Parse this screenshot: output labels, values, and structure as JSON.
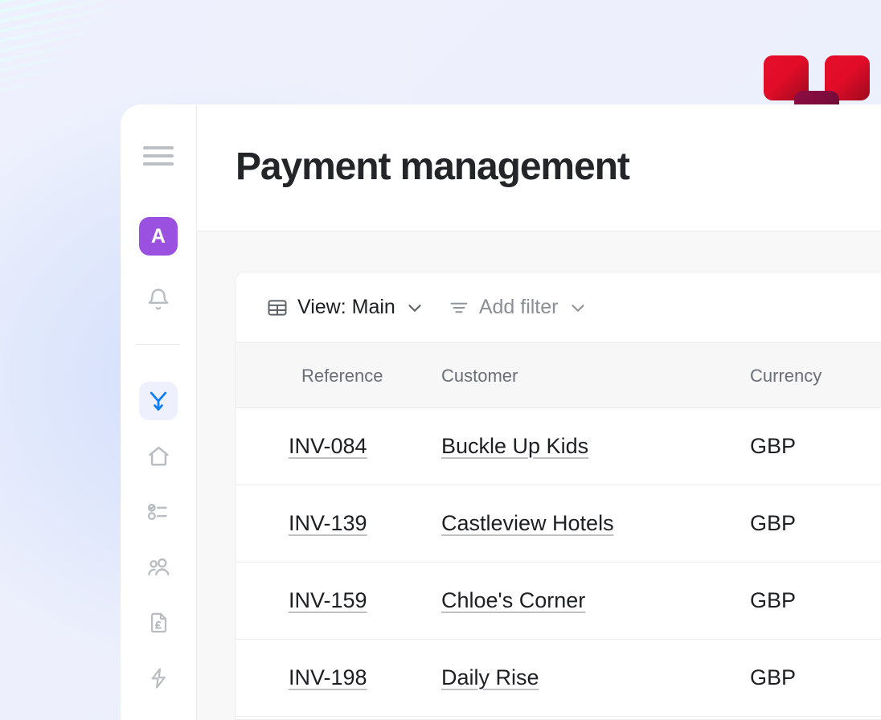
{
  "window": {
    "title": "Payment management"
  },
  "logo": {
    "name": "brand-logo-mark",
    "colors": {
      "red": "#e20c28",
      "red_dark": "#9d0a1f",
      "maroon": "#7d0b3c",
      "maroon_dark": "#4f0624",
      "gray": "#adadad",
      "gray_dark": "#6d6d6d"
    }
  },
  "sidebar": {
    "avatar_initial": "A",
    "avatar_color": "#9b51e0",
    "active_color": "#0a7cfa",
    "items": [
      {
        "icon": "hamburger-menu-icon",
        "active": false
      },
      {
        "icon": "avatar",
        "active": false
      },
      {
        "icon": "bell-icon",
        "active": false
      },
      {
        "icon": "flow-merge-arrow-icon",
        "active": true
      },
      {
        "icon": "home-icon",
        "active": false
      },
      {
        "icon": "checklist-icon",
        "active": false
      },
      {
        "icon": "people-icon",
        "active": false
      },
      {
        "icon": "document-pound-icon",
        "active": false
      },
      {
        "icon": "lightning-bolt-icon",
        "active": false
      }
    ]
  },
  "toolbar": {
    "view_label": "View: Main",
    "view_icon": "table-icon",
    "filter_label": "Add filter",
    "filter_icon": "filter-lines-icon",
    "caret_icon": "chevron-down-icon"
  },
  "table": {
    "columns": [
      "Reference",
      "Customer",
      "Currency"
    ],
    "rows": [
      {
        "reference": "INV-084",
        "customer": "Buckle Up Kids",
        "currency": "GBP"
      },
      {
        "reference": "INV-139",
        "customer": "Castleview Hotels",
        "currency": "GBP"
      },
      {
        "reference": "INV-159",
        "customer": "Chloe's Corner",
        "currency": "GBP"
      },
      {
        "reference": "INV-198",
        "customer": "Daily Rise",
        "currency": "GBP"
      }
    ]
  }
}
